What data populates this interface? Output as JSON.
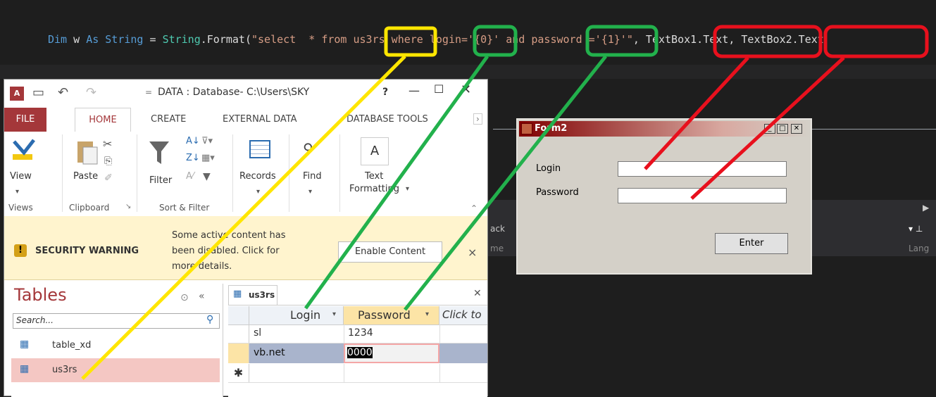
{
  "code": {
    "dim": "Dim",
    "w": " w ",
    "as": "As",
    "string_type": " String",
    "eq": " = ",
    "string_cls": "String",
    "format": ".Format(",
    "sql": "\"select  * from us3rs where login='{0}' and password ='{1}'\"",
    "comma1": ", ",
    "arg1": "TextBox1.Text",
    "comma2": ", ",
    "arg2": "TextBox2.Text"
  },
  "vs": {
    "panel_left": "ack",
    "panel_sub": "me",
    "panel_right": "Lang"
  },
  "access": {
    "title": "DATA : Database- C:\\Users\\SKY",
    "help": "?",
    "tabs": [
      "FILE",
      "HOME",
      "CREATE",
      "EXTERNAL DATA",
      "DATABASE TOOLS"
    ],
    "ribbon": {
      "view": "View",
      "paste": "Paste",
      "filter": "Filter",
      "records": "Records",
      "find": "Find",
      "text": "Text",
      "formatting": "Formatting",
      "groups": [
        "Views",
        "Clipboard",
        "Sort & Filter"
      ]
    },
    "security": {
      "label": "SECURITY WARNING",
      "message1": "Some active content has",
      "message2": "been disabled. Click for",
      "message3": "more details.",
      "button": "Enable Content",
      "close": "×"
    },
    "nav": {
      "header": "Tables",
      "search_placeholder": "Search...",
      "items": [
        "table_xd",
        "us3rs"
      ]
    },
    "datasheet": {
      "tab": "us3rs",
      "columns": [
        "Login",
        "Password",
        "Click to"
      ],
      "rows": [
        [
          "sl",
          "1234"
        ],
        [
          "vb.net",
          "0000"
        ]
      ]
    }
  },
  "form2": {
    "title": "Form2",
    "login_label": "Login",
    "password_label": "Password",
    "enter_button": "Enter",
    "login_value": "",
    "password_value": ""
  },
  "colors": {
    "yellow": "#ffe600",
    "green": "#22b14c",
    "red": "#e8101d"
  }
}
